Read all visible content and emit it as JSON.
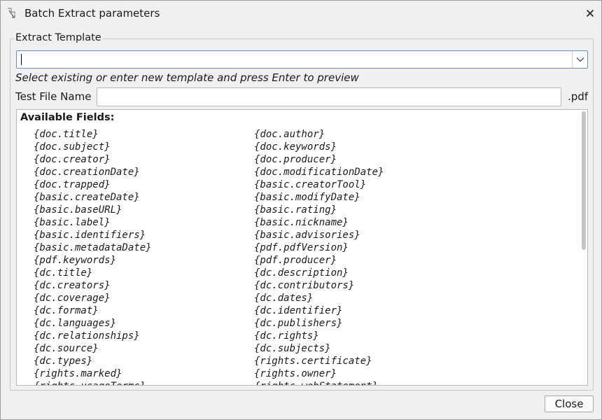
{
  "window": {
    "title": "Batch Extract parameters"
  },
  "group": {
    "title": "Extract Template"
  },
  "combo": {
    "value": "",
    "placeholder": ""
  },
  "hint": "Select existing or enter new template and press Enter to preview",
  "test_file": {
    "label": "Test File Name",
    "value": "",
    "extension": ".pdf"
  },
  "fields": {
    "heading": "Available Fields:",
    "left": [
      "{doc.title}",
      "{doc.subject}",
      "{doc.creator}",
      "{doc.creationDate}",
      "{doc.trapped}",
      "{basic.createDate}",
      "{basic.baseURL}",
      "{basic.label}",
      "{basic.identifiers}",
      "{basic.metadataDate}",
      "{pdf.keywords}",
      "{dc.title}",
      "{dc.creators}",
      "{dc.coverage}",
      "{dc.format}",
      "{dc.languages}",
      "{dc.relationships}",
      "{dc.source}",
      "{dc.types}",
      "{rights.marked}",
      "{rights.usageTerms}"
    ],
    "right": [
      "{doc.author}",
      "{doc.keywords}",
      "{doc.producer}",
      "{doc.modificationDate}",
      "{basic.creatorTool}",
      "{basic.modifyDate}",
      "{basic.rating}",
      "{basic.nickname}",
      "{basic.advisories}",
      "{pdf.pdfVersion}",
      "{pdf.producer}",
      "{dc.description}",
      "{dc.contributors}",
      "{dc.dates}",
      "{dc.identifier}",
      "{dc.publishers}",
      "{dc.rights}",
      "{dc.subjects}",
      "{rights.certificate}",
      "{rights.owner}",
      "{rights.webStatement}"
    ]
  },
  "buttons": {
    "close_label": "Close"
  },
  "colors": {
    "focus_border": "#6a8ccf",
    "scrollbar_thumb": "#c4c4c4"
  },
  "icons": {
    "app": "app-icon",
    "close": "close-icon",
    "dropdown": "chevron-down-icon"
  }
}
